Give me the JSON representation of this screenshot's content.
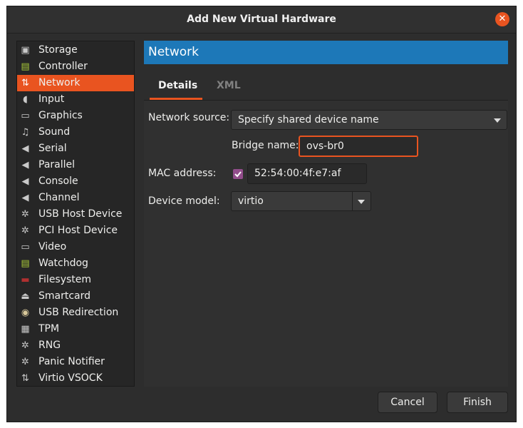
{
  "window": {
    "title": "Add New Virtual Hardware"
  },
  "sidebar": {
    "items": [
      {
        "label": "Storage",
        "icon": "disk-icon"
      },
      {
        "label": "Controller",
        "icon": "controller-icon"
      },
      {
        "label": "Network",
        "icon": "network-icon",
        "selected": true
      },
      {
        "label": "Input",
        "icon": "mouse-icon"
      },
      {
        "label": "Graphics",
        "icon": "monitor-icon"
      },
      {
        "label": "Sound",
        "icon": "sound-icon"
      },
      {
        "label": "Serial",
        "icon": "serial-icon"
      },
      {
        "label": "Parallel",
        "icon": "parallel-icon"
      },
      {
        "label": "Console",
        "icon": "console-icon"
      },
      {
        "label": "Channel",
        "icon": "channel-icon"
      },
      {
        "label": "USB Host Device",
        "icon": "usb-device-icon"
      },
      {
        "label": "PCI Host Device",
        "icon": "pci-device-icon"
      },
      {
        "label": "Video",
        "icon": "video-icon"
      },
      {
        "label": "Watchdog",
        "icon": "watchdog-icon"
      },
      {
        "label": "Filesystem",
        "icon": "folder-icon"
      },
      {
        "label": "Smartcard",
        "icon": "smartcard-icon"
      },
      {
        "label": "USB Redirection",
        "icon": "usb-redirection-icon"
      },
      {
        "label": "TPM",
        "icon": "tpm-chip-icon"
      },
      {
        "label": "RNG",
        "icon": "rng-icon"
      },
      {
        "label": "Panic Notifier",
        "icon": "panic-notifier-icon"
      },
      {
        "label": "Virtio VSOCK",
        "icon": "vsock-icon"
      }
    ]
  },
  "panel": {
    "title": "Network"
  },
  "tabs": {
    "details": "Details",
    "xml": "XML"
  },
  "form": {
    "network_source_label": "Network source:",
    "network_source_value": "Specify shared device name",
    "bridge_label": "Bridge name:",
    "bridge_value": "ovs-br0",
    "mac_label": "MAC address:",
    "mac_checked": true,
    "mac_value": "52:54:00:4f:e7:af",
    "device_model_label": "Device model:",
    "device_model_value": "virtio"
  },
  "buttons": {
    "cancel": "Cancel",
    "finish": "Finish"
  },
  "colors": {
    "accent": "#e95420",
    "header": "#1d78b8",
    "checkbox": "#924d8b"
  }
}
